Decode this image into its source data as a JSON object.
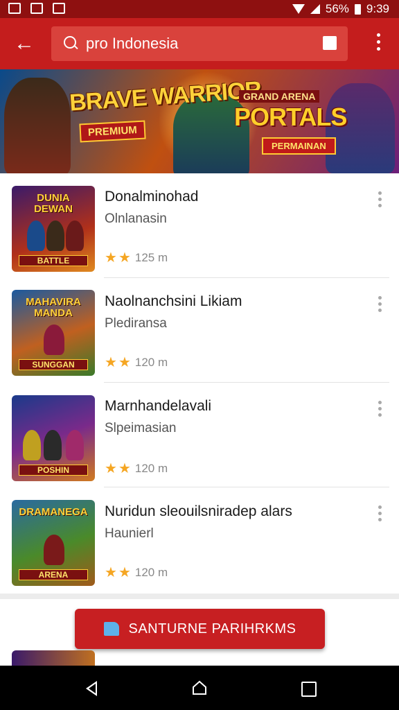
{
  "status": {
    "battery": "56%",
    "time": "9:39"
  },
  "appbar": {
    "search_value": "pro Indonesia"
  },
  "banner": {
    "left_title": "BRAVE WARRIOR",
    "left_subtitle": "PREMIUM",
    "right_top": "GRAND ARENA",
    "right_title": "PORTALS",
    "right_subtitle": "PERMAINAN"
  },
  "list": [
    {
      "title": "Donalminohad",
      "subtitle": "Olnlanasin",
      "stars": 2,
      "size": "125 m",
      "thumb_title": "DUNIA DEWAN",
      "thumb_badge": "BATTLE"
    },
    {
      "title": "Naolnanchsini Likiam",
      "subtitle": "Plediransa",
      "stars": 2,
      "size": "120 m",
      "thumb_title": "MAHAVIRA MANDA",
      "thumb_badge": "SUNGGAN"
    },
    {
      "title": "Marnhandelavali",
      "subtitle": "Slpeimasian",
      "stars": 2,
      "size": "120 m",
      "thumb_title": "",
      "thumb_badge": "POSHIN"
    },
    {
      "title": "Nuridun sleouilsniradep alars",
      "subtitle": "Haunierl",
      "stars": 2,
      "size": "120 m",
      "thumb_title": "DRAMANEGA",
      "thumb_badge": "ARENA"
    }
  ],
  "cta": {
    "label": "SANTURNE PARIHRKMS"
  },
  "colors": {
    "appbar": "#c41d1d",
    "statusbar": "#8e1010",
    "cta": "#c71f22",
    "star": "#f5a623"
  },
  "icons": {
    "back": "arrow-left-icon",
    "search": "search-icon",
    "overflow": "more-vertical-icon"
  }
}
